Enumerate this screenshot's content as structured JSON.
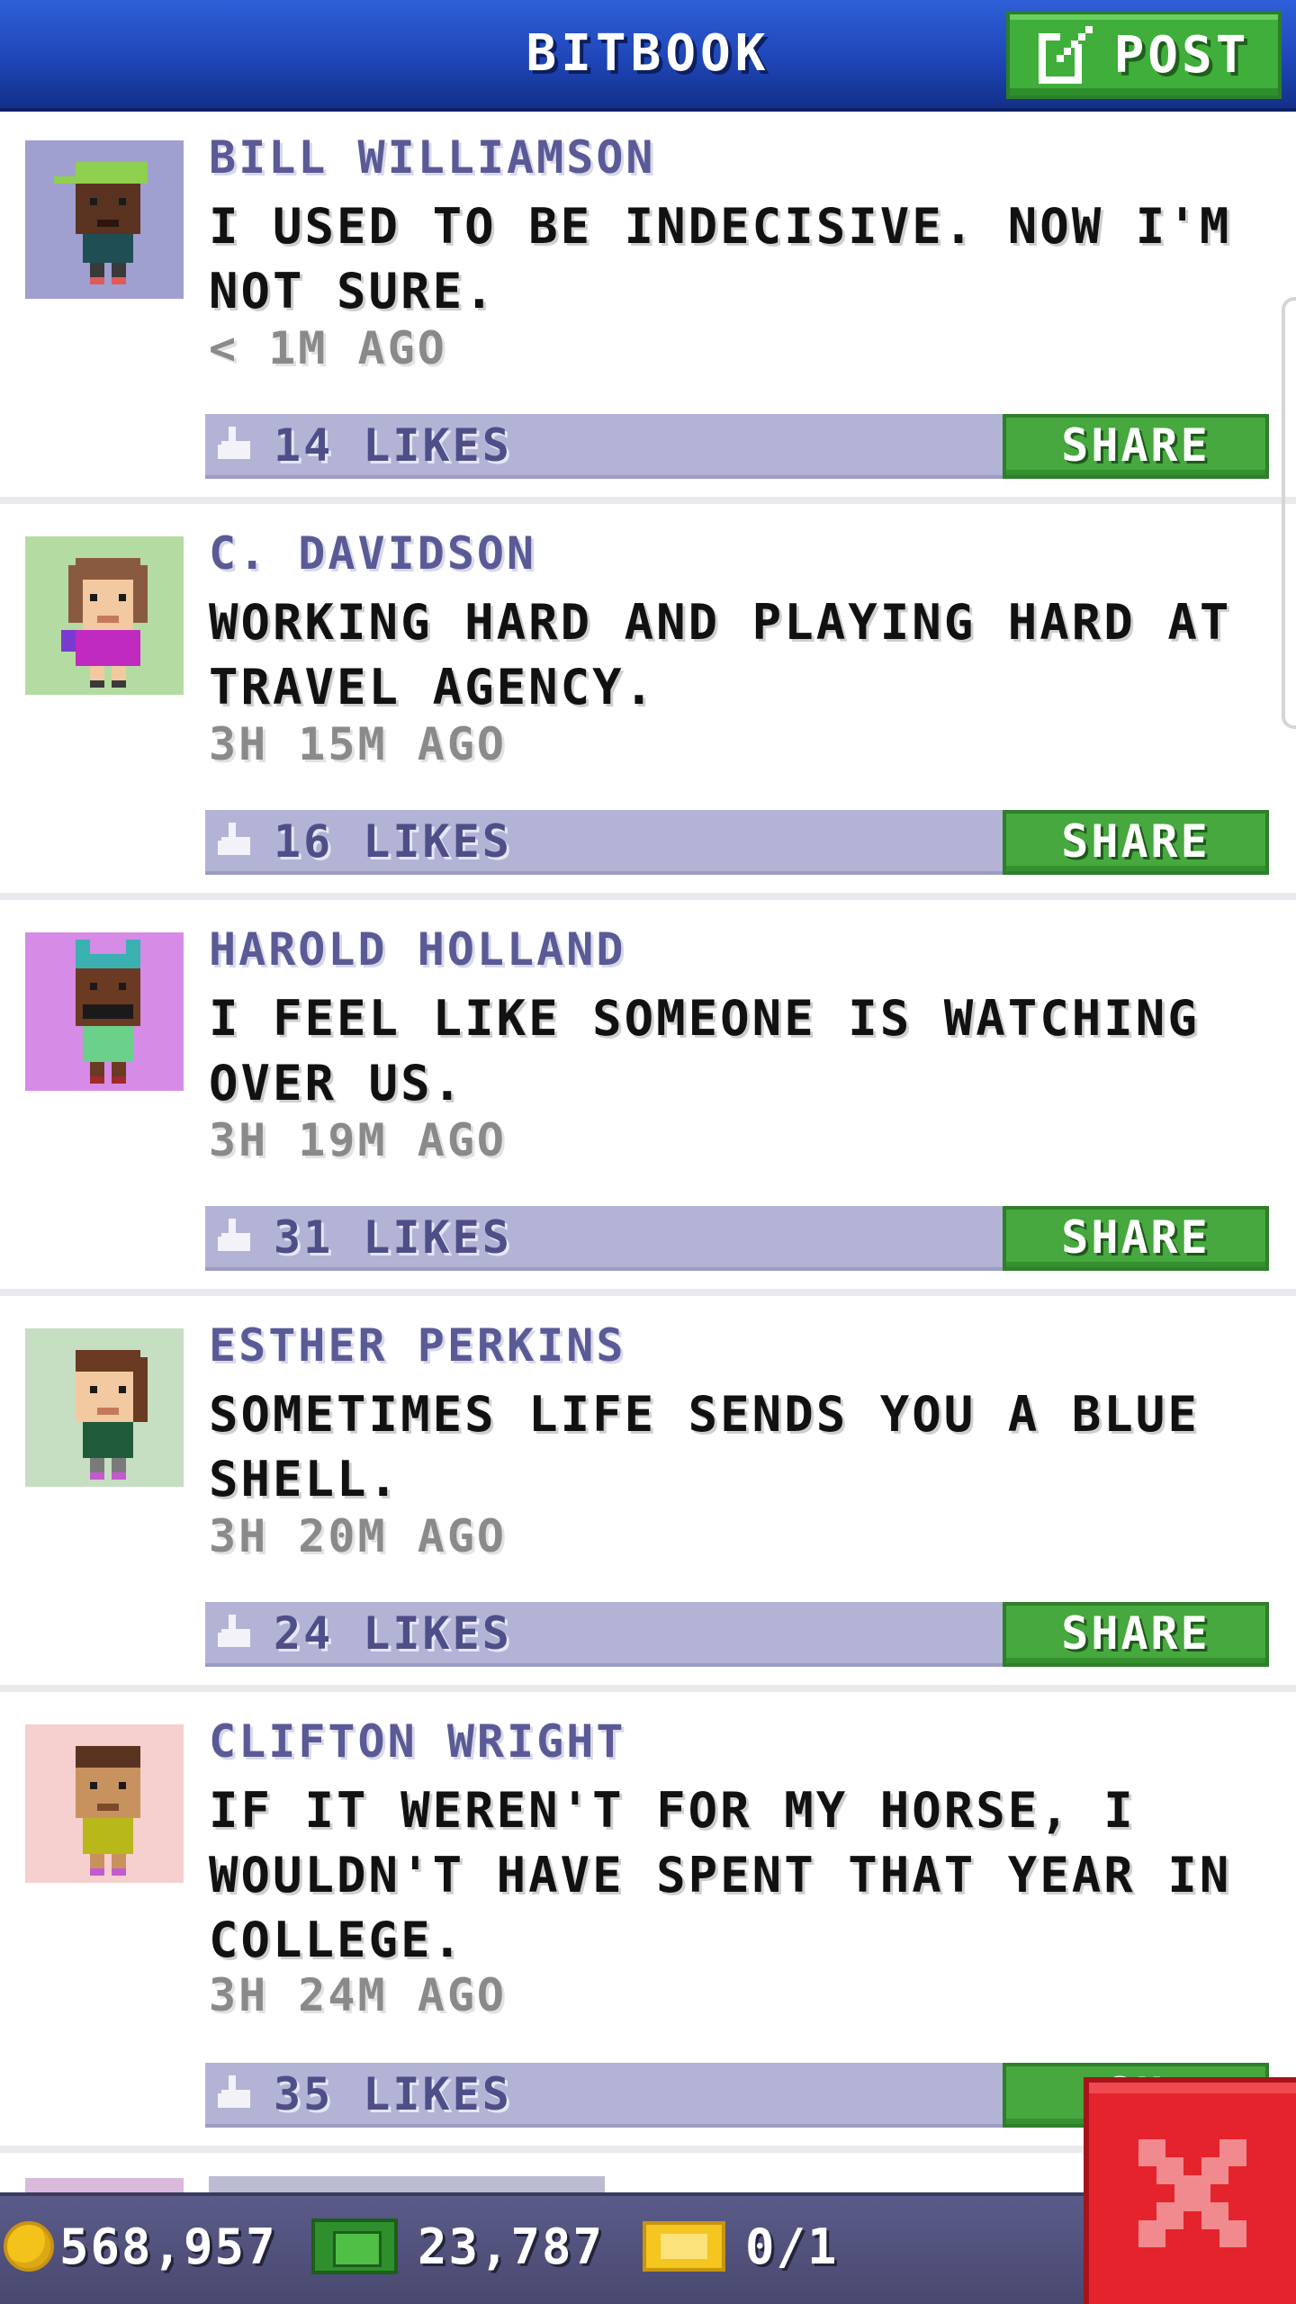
{
  "header": {
    "title": "BITBOOK",
    "post_label": "POST"
  },
  "posts": [
    {
      "name": "BILL WILLIAMSON",
      "text": "I USED TO BE INDECISIVE. NOW I'M NOT SURE.",
      "time": "< 1M AGO",
      "likes": "14 LIKES",
      "share": "SHARE"
    },
    {
      "name": "C. DAVIDSON",
      "text": "WORKING HARD AND PLAYING HARD AT TRAVEL AGENCY.",
      "time": "3H 15M AGO",
      "likes": "16 LIKES",
      "share": "SHARE"
    },
    {
      "name": "HAROLD HOLLAND",
      "text": "I FEEL LIKE SOMEONE IS WATCHING OVER US.",
      "time": "3H 19M AGO",
      "likes": "31 LIKES",
      "share": "SHARE"
    },
    {
      "name": "ESTHER PERKINS",
      "text": "SOMETIMES LIFE SENDS YOU A BLUE SHELL.",
      "time": "3H 20M AGO",
      "likes": "24 LIKES",
      "share": "SHARE"
    },
    {
      "name": "CLIFTON WRIGHT",
      "text": "IF IT WEREN'T FOR MY HORSE, I WOULDN'T HAVE SPENT THAT YEAR IN COLLEGE.",
      "time": "3H 24M AGO",
      "likes": "35 LIKES",
      "share": "SH"
    }
  ],
  "stats": {
    "coins": "568,957",
    "bux": "23,787",
    "tickets": "0/1"
  },
  "icons": {
    "post": "edit-icon",
    "like": "thumbs-up-icon",
    "coin": "coin-icon",
    "bux": "bux-icon",
    "ticket": "ticket-icon",
    "close": "close-icon"
  },
  "colors": {
    "header": "#1f46b8",
    "name": "#5a5a96",
    "like_bar": "#b3b3d6",
    "share": "#46a83e",
    "close": "#e5232c"
  }
}
